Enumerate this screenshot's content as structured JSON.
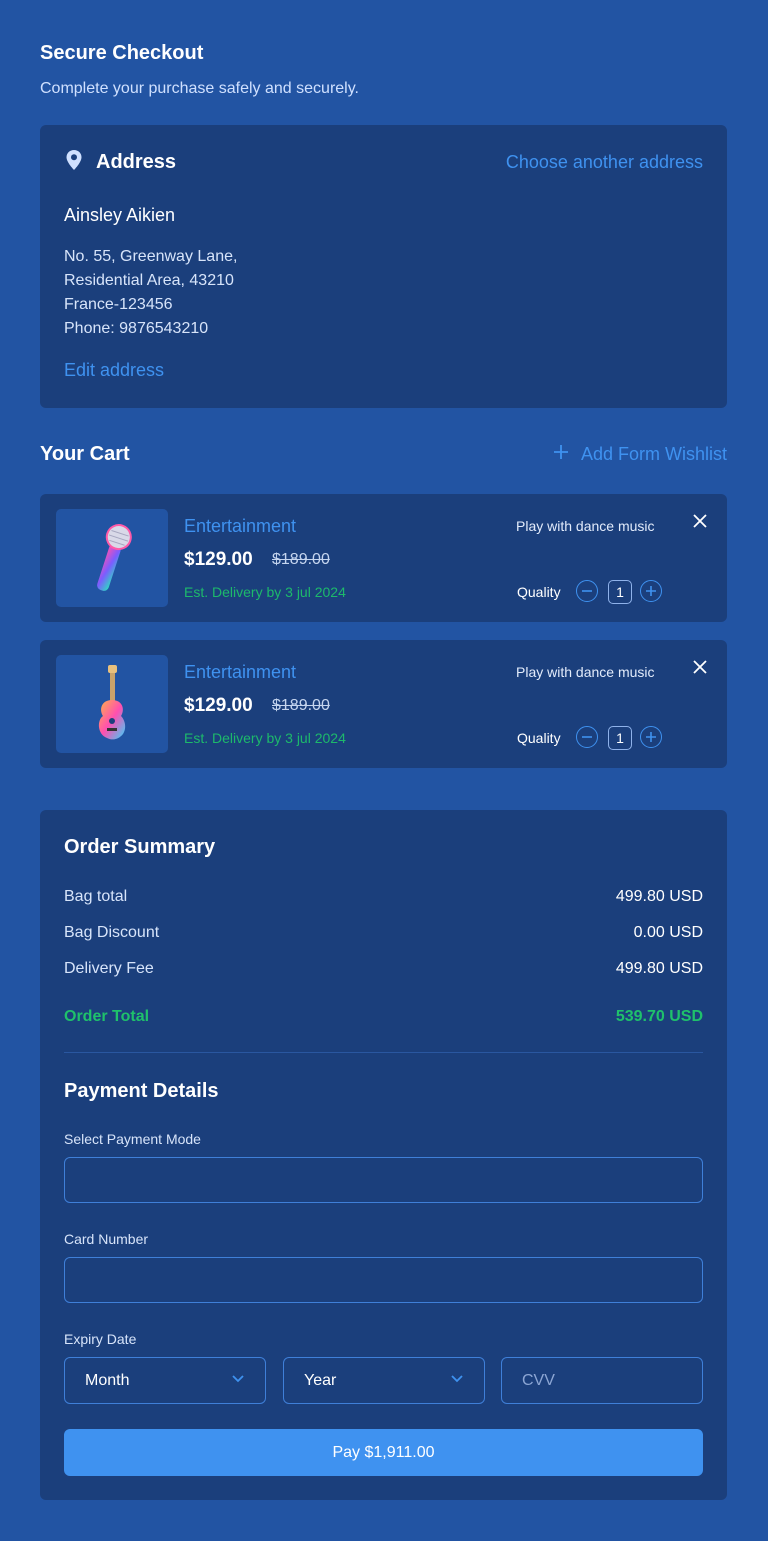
{
  "header": {
    "title": "Secure Checkout",
    "subtitle": "Complete your purchase safely and securely."
  },
  "address": {
    "title": "Address",
    "choose_link": "Choose another address",
    "name": "Ainsley Aikien",
    "line1": "No. 55, Greenway Lane,",
    "line2": "Residential Area, 43210",
    "line3": "France-123456",
    "phone": "Phone: 9876543210",
    "edit_link": "Edit address"
  },
  "cart": {
    "title": "Your Cart",
    "wishlist_label": "Add Form Wishlist",
    "items": [
      {
        "category": "Entertainment",
        "price": "$129.00",
        "old_price": "$189.00",
        "delivery": "Est. Delivery by 3 jul 2024",
        "description": "Play with dance music",
        "quantity_label": "Quality",
        "quantity": "1",
        "image": "microphone-image"
      },
      {
        "category": "Entertainment",
        "price": "$129.00",
        "old_price": "$189.00",
        "delivery": "Est. Delivery by 3 jul 2024",
        "description": "Play with dance music",
        "quantity_label": "Quality",
        "quantity": "1",
        "image": "guitar-image"
      }
    ]
  },
  "summary": {
    "title": "Order Summary",
    "rows": [
      {
        "label": "Bag total",
        "value": "499.80 USD"
      },
      {
        "label": "Bag Discount",
        "value": "0.00 USD"
      },
      {
        "label": "Delivery Fee",
        "value": "499.80 USD"
      }
    ],
    "total_label": "Order Total",
    "total_value": "539.70 USD"
  },
  "payment": {
    "title": "Payment Details",
    "mode_label": "Select Payment Mode",
    "mode_value": "",
    "card_label": "Card Number",
    "card_value": "",
    "expiry_label": "Expiry Date",
    "month_placeholder": "Month",
    "year_placeholder": "Year",
    "cvv_placeholder": "CVV",
    "pay_button": "Pay $1,911.00"
  },
  "colors": {
    "background": "#2254a3",
    "card": "#1b3f7c",
    "accent": "#3f92f0",
    "success": "#1fc16b"
  }
}
